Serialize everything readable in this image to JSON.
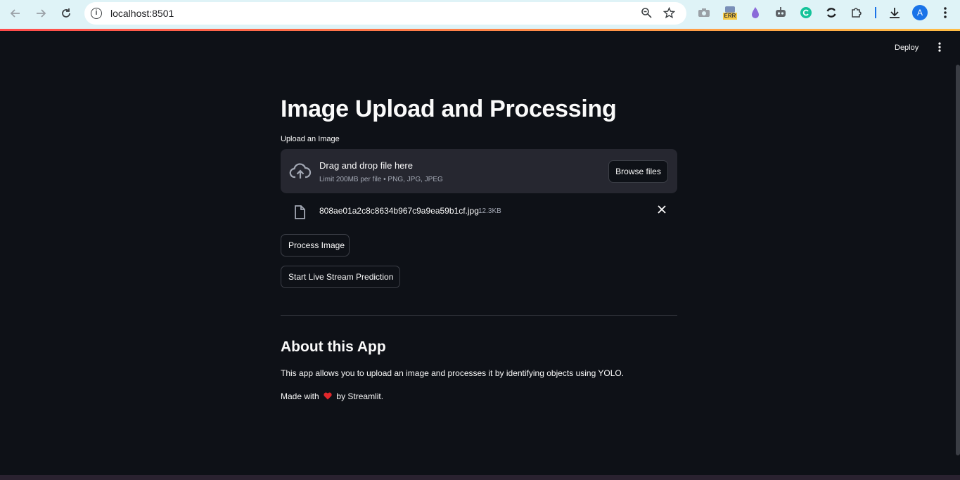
{
  "browser": {
    "url": "localhost:8501",
    "extensions": [
      "camera-icon",
      "err-badge-icon",
      "drop-icon",
      "robot-icon",
      "grammarly-icon",
      "sync-icon",
      "puzzle-icon"
    ],
    "err_badge": "ERR",
    "profile_initial": "A"
  },
  "header": {
    "deploy_label": "Deploy"
  },
  "main": {
    "title": "Image Upload and Processing",
    "upload_label": "Upload an Image",
    "dropzone": {
      "main_text": "Drag and drop file here",
      "sub_text": "Limit 200MB per file • PNG, JPG, JPEG",
      "browse_label": "Browse files"
    },
    "uploaded_file": {
      "name": "808ae01a2c8c8634b967c9a9ea59b1cf.jpg",
      "size": "12.3KB"
    },
    "process_button": "Process Image",
    "live_button": "Start Live Stream Prediction",
    "about_heading": "About this App",
    "about_text": "This app allows you to upload an image and processes it by identifying objects using YOLO.",
    "made_with_prefix": "Made with",
    "made_with_suffix": "by Streamlit."
  },
  "colors": {
    "background": "#0e1117",
    "dropzone": "#262730",
    "accent_start": "#ff4b4b",
    "accent_end": "#ffbd45",
    "text": "#fafafa",
    "muted": "#a3a8b4"
  }
}
